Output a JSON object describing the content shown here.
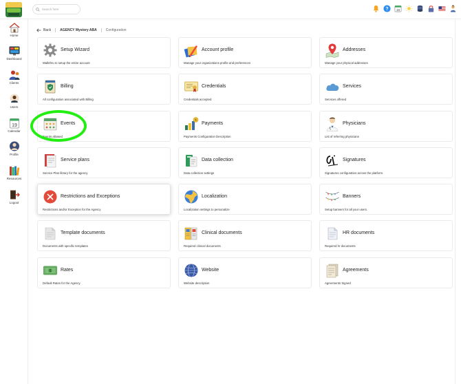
{
  "header": {
    "search_placeholder": "Search here"
  },
  "sidebar": {
    "items": [
      {
        "label": "Home",
        "icon": "home-icon"
      },
      {
        "label": "Dashboard",
        "icon": "dashboard-icon"
      },
      {
        "label": "Clients",
        "icon": "clients-icon"
      },
      {
        "label": "Users",
        "icon": "users-icon"
      },
      {
        "label": "Calendar",
        "icon": "calendar-icon",
        "badge": "19"
      },
      {
        "label": "Profile",
        "icon": "profile-icon"
      },
      {
        "label": "Resources",
        "icon": "resources-icon"
      },
      {
        "label": "Logout",
        "icon": "logout-icon"
      }
    ]
  },
  "breadcrumb": {
    "back": "Back",
    "agency": "AGENCY Mystery ABA",
    "current": "Configuration"
  },
  "calendar_badge": "19",
  "cards": [
    {
      "title": "Setup Wizard",
      "desc": "Walkthru to setup the entire account",
      "icon": "gear-icon"
    },
    {
      "title": "Account profile",
      "desc": "Manage your organizations profile and preferences",
      "icon": "profile-edit-icon"
    },
    {
      "title": "Addresses",
      "desc": "Manage your physical addresses",
      "icon": "map-pin-icon"
    },
    {
      "title": "Billing",
      "desc": "All configuration associated with Billing",
      "icon": "billing-icon"
    },
    {
      "title": "Credentials",
      "desc": "Credentials accepted",
      "icon": "certificate-icon"
    },
    {
      "title": "Services",
      "desc": "Services offered",
      "icon": "cloud-icon"
    },
    {
      "title": "Events",
      "desc": "Events allowed",
      "icon": "events-calendar-icon"
    },
    {
      "title": "Payments",
      "desc": "Payments Configuration Description",
      "icon": "payments-icon"
    },
    {
      "title": "Physicians",
      "desc": "List of referring physicians",
      "icon": "physician-icon"
    },
    {
      "title": "Service plans",
      "desc": "Service Plan library for the agency",
      "icon": "service-plan-icon"
    },
    {
      "title": "Data collection",
      "desc": "Data collection settings",
      "icon": "data-collection-icon"
    },
    {
      "title": "Signatures",
      "desc": "Signatures configuration across the platform.",
      "icon": "signature-icon"
    },
    {
      "title": "Restrictions and Exceptions",
      "desc": "Restrictions and/or Exception for the Agency",
      "icon": "restriction-icon"
    },
    {
      "title": "Localization",
      "desc": "Localization settings to personalize",
      "icon": "globe-icon"
    },
    {
      "title": "Banners",
      "desc": "Setup banners for all your users.",
      "icon": "banner-icon"
    },
    {
      "title": "Template documents",
      "desc": "Documents with specific templates",
      "icon": "template-icon"
    },
    {
      "title": "Clinical documents",
      "desc": "Required clinical documents",
      "icon": "clinical-docs-icon"
    },
    {
      "title": "HR documents",
      "desc": "Required hr documents",
      "icon": "hr-docs-icon"
    },
    {
      "title": "Rates",
      "desc": "Default Rates for the Agency",
      "icon": "money-icon"
    },
    {
      "title": "Website",
      "desc": "Website description",
      "icon": "website-globe-icon"
    },
    {
      "title": "Agreements",
      "desc": "Agreements Signed",
      "icon": "agreements-icon"
    }
  ]
}
